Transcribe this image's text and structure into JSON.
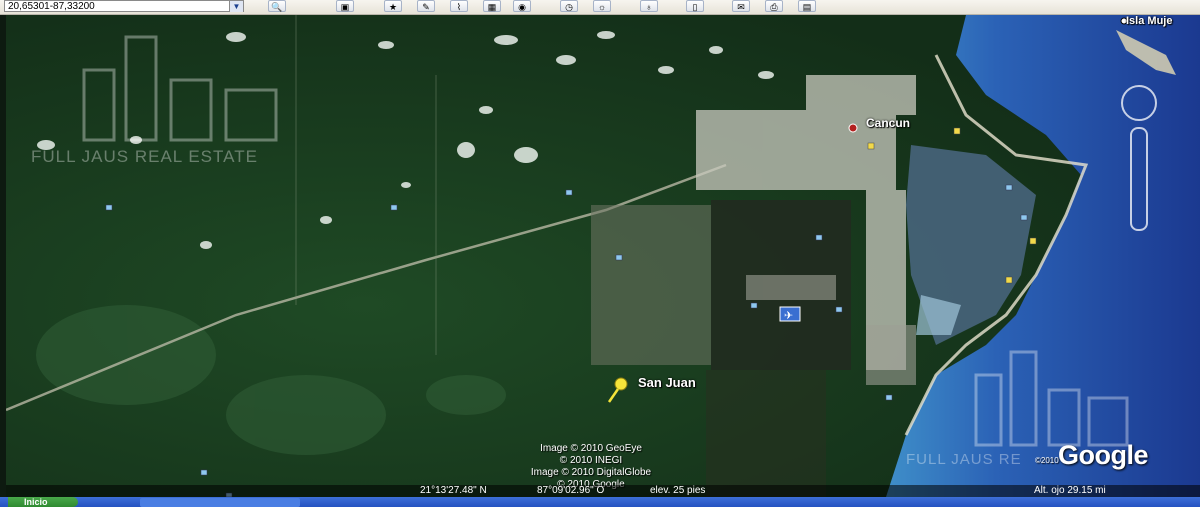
{
  "toolbar": {
    "coordinates_value": "20,65301-87,33200",
    "dropdown_arrow": "▼",
    "buttons": [
      {
        "icon": "search-icon",
        "glyph": "🔍"
      },
      {
        "icon": "sidebar-toggle-icon",
        "glyph": "▣"
      },
      {
        "icon": "placemark-icon",
        "glyph": "★"
      },
      {
        "icon": "polygon-icon",
        "glyph": "✎"
      },
      {
        "icon": "path-icon",
        "glyph": "⌇"
      },
      {
        "icon": "image-overlay-icon",
        "glyph": "▦"
      },
      {
        "icon": "record-tour-icon",
        "glyph": "◉"
      },
      {
        "icon": "historical-imagery-icon",
        "glyph": "◷"
      },
      {
        "icon": "sunlight-icon",
        "glyph": "☼"
      },
      {
        "icon": "planet-switch-icon",
        "glyph": "♁"
      },
      {
        "icon": "ruler-icon",
        "glyph": "▯"
      },
      {
        "icon": "email-icon",
        "glyph": "✉"
      },
      {
        "icon": "print-icon",
        "glyph": "⎙"
      },
      {
        "icon": "view-in-maps-icon",
        "glyph": "▤"
      }
    ]
  },
  "map": {
    "labels": {
      "cancun": "Cancun",
      "san_juan": "San Juan",
      "isla_mujeres": "Isla Muje"
    },
    "credits": [
      "Image © 2010 GeoEye",
      "© 2010 INEGI",
      "Image © 2010 DigitalGlobe",
      "© 2010 Google"
    ],
    "google_logo": "Google",
    "google_copyright": "©2010",
    "watermark": "FULL JAUS REAL ESTATE",
    "watermark2": "FULL JAUS RE"
  },
  "status": {
    "latitude": "21°13'27.48\" N",
    "longitude": "87°09'02.96\" O",
    "elevation": "elev.   25 pies",
    "eye_altitude": "Alt. ojo    29.15 mi"
  },
  "taskbar": {
    "start_label": "Inicio"
  },
  "colors": {
    "ocean_deep": "#1d3f95",
    "ocean_shallow": "#5aa7d8",
    "jungle": "#163a1e",
    "taskbar": "#2a5acb"
  }
}
